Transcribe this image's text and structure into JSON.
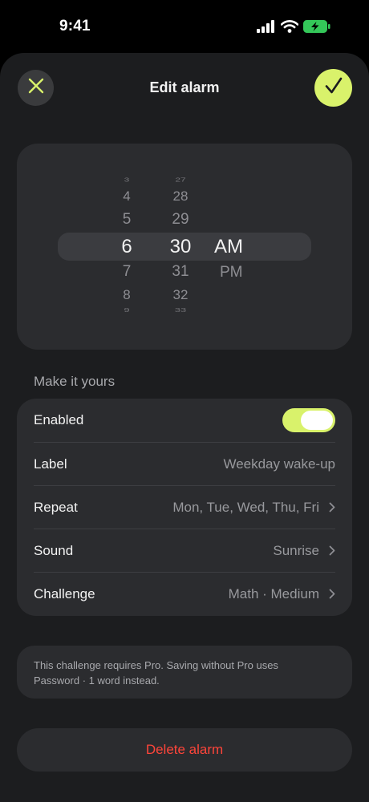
{
  "status_bar": {
    "time": "9:41"
  },
  "header": {
    "title": "Edit alarm",
    "close_icon": "close-icon",
    "confirm_icon": "checkmark-icon"
  },
  "picker": {
    "hours": [
      "3",
      "4",
      "5",
      "6",
      "7",
      "8",
      "9"
    ],
    "minutes": [
      "27",
      "28",
      "29",
      "30",
      "31",
      "32",
      "33"
    ],
    "periods": [
      "AM",
      "PM"
    ],
    "selected": {
      "hour": "6",
      "minute": "30",
      "period": "AM"
    }
  },
  "settings": {
    "section_title": "Make it yours",
    "enabled": {
      "label": "Enabled",
      "value": true
    },
    "label": {
      "label": "Label",
      "value": "Weekday wake-up"
    },
    "repeat": {
      "label": "Repeat",
      "value": "Mon, Tue, Wed, Thu, Fri"
    },
    "sound": {
      "label": "Sound",
      "value": "Sunrise"
    },
    "challenge": {
      "label": "Challenge",
      "value": "Math · Medium"
    }
  },
  "note": {
    "line1": "This challenge requires Pro. Saving without Pro uses",
    "line2": "Password · 1 word instead."
  },
  "delete_label": "Delete alarm",
  "colors": {
    "accent": "#d9f26b",
    "destructive": "#ff453a",
    "card": "#2b2c2f",
    "sheet": "#1c1d1f"
  }
}
